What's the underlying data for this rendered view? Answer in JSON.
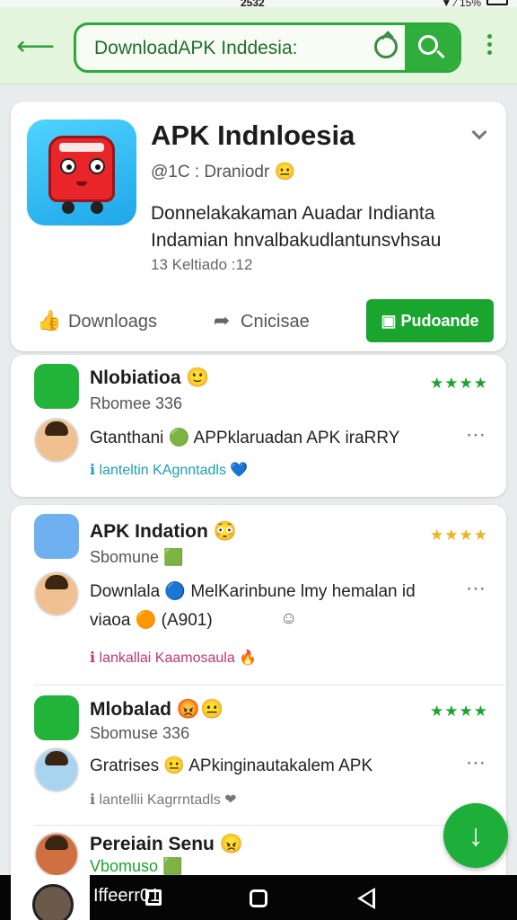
{
  "status": {
    "time": "2532",
    "right": "▼ ⁄ 15%"
  },
  "search": {
    "value": "DownloadAPK Inddesia:"
  },
  "hero": {
    "title": "APK Indnloesia",
    "developer": "@1C : Draniodr 😐",
    "description_line1": "Donnelakakaman Auadar Indianta",
    "description_line2": "Indamian hnvalbakudlantunsvhsau",
    "meta": "13 Keltiado :12",
    "download_label": "Downloags",
    "share_label": "Cnicisae",
    "install_label": "Pudoande"
  },
  "reviews": [
    {
      "app_name": "Nlobiatioa 🙂",
      "app_sub": "Rbomee 336",
      "stars": "★★★★",
      "stars_color": "#1aa52e",
      "comment": "Gtanthani 🟢 APPklaruadan APK iraRRY",
      "like_text": "ℹ lanteltin KAgnntadls 💙",
      "like_color": "#1b9fb5"
    },
    {
      "app_name": "APK Indation 😳",
      "app_sub": "Sbomune 🟩",
      "stars": "★★★★",
      "stars_color": "#f1b31c",
      "comment_line1": "Downlala 🔵 MelKarinbune lmy hemalan id",
      "comment_line2": "viaoa 🟠 (A901)",
      "comment_extra": "☺",
      "like_text": "ℹ lankallai Kaamosaula 🔥",
      "like_color": "#c2347a"
    },
    {
      "app_name": "Mlobalad 😡😐",
      "app_sub": "Sbomuse 336",
      "stars": "★★★★",
      "stars_color": "#1aa52e",
      "comment": "Gratrises 😐 APkinginautakalem APK",
      "like_text": "ℹ lantellii Kagrrntadls ❤",
      "like_color": "#777777"
    },
    {
      "app_name": "Pereiain Senu 😠",
      "app_sub": "Vbomuso 🟩",
      "stars": "★",
      "stars_color": "#e02a2a"
    }
  ],
  "navbar": {
    "label": "Iffeerr01"
  }
}
